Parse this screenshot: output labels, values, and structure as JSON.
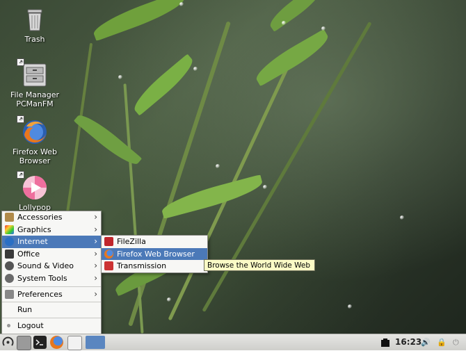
{
  "desktop": {
    "icons": [
      {
        "label": "Trash",
        "icon": "trash-icon"
      },
      {
        "label": "File Manager PCManFM",
        "icon": "file-manager-icon"
      },
      {
        "label": "Firefox Web Browser",
        "icon": "firefox-icon"
      },
      {
        "label": "Lollypop",
        "icon": "lollypop-icon"
      }
    ]
  },
  "main_menu": {
    "items": [
      {
        "label": "Accessories",
        "icon": "accessories-icon"
      },
      {
        "label": "Graphics",
        "icon": "graphics-icon"
      },
      {
        "label": "Internet",
        "icon": "internet-icon"
      },
      {
        "label": "Office",
        "icon": "office-icon"
      },
      {
        "label": "Sound & Video",
        "icon": "sound-video-icon"
      },
      {
        "label": "System Tools",
        "icon": "system-tools-icon"
      },
      {
        "label": "Preferences",
        "icon": "preferences-icon"
      },
      {
        "label": "Run",
        "icon": ""
      },
      {
        "label": "Logout",
        "icon": "logout-icon"
      }
    ],
    "highlighted": "Internet"
  },
  "internet_submenu": {
    "items": [
      {
        "label": "FileZilla",
        "icon": "filezilla-icon"
      },
      {
        "label": "Firefox Web Browser",
        "icon": "firefox-icon"
      },
      {
        "label": "Transmission",
        "icon": "transmission-icon"
      }
    ],
    "highlighted": "Firefox Web Browser"
  },
  "tooltip": {
    "text": "Browse the World Wide Web"
  },
  "taskbar": {
    "clock": "16:23",
    "launchers": [
      "menu-icon",
      "file-manager-icon",
      "terminal-icon",
      "firefox-icon",
      "show-desktop-icon"
    ]
  },
  "colors": {
    "highlight": "#4b79b8",
    "tooltip_bg": "#fbfbc6",
    "menu_bg": "#f7f7f5"
  }
}
